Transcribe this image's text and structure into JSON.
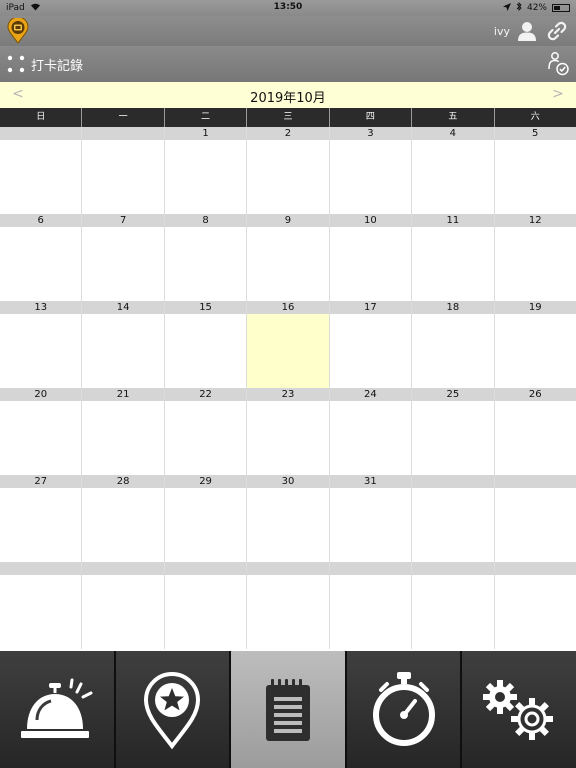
{
  "status_bar": {
    "device": "iPad",
    "time": "13:50",
    "battery": "42%",
    "battery_level": 0.42
  },
  "header": {
    "user_name": "ivy",
    "page_title": "打卡記錄"
  },
  "calendar": {
    "month_title": "2019年10月",
    "prev_label": "<",
    "next_label": ">",
    "weekdays": [
      "日",
      "一",
      "二",
      "三",
      "四",
      "五",
      "六"
    ],
    "today": "16",
    "weeks": [
      [
        "",
        "",
        "1",
        "2",
        "3",
        "4",
        "5"
      ],
      [
        "6",
        "7",
        "8",
        "9",
        "10",
        "11",
        "12"
      ],
      [
        "13",
        "14",
        "15",
        "16",
        "17",
        "18",
        "19"
      ],
      [
        "20",
        "21",
        "22",
        "23",
        "24",
        "25",
        "26"
      ],
      [
        "27",
        "28",
        "29",
        "30",
        "31",
        "",
        ""
      ],
      [
        "",
        "",
        "",
        "",
        "",
        "",
        ""
      ]
    ]
  },
  "tab_bar": {
    "active_index": 2,
    "tabs": [
      {
        "icon": "service-bell-icon"
      },
      {
        "icon": "location-star-icon"
      },
      {
        "icon": "notepad-icon"
      },
      {
        "icon": "stopwatch-icon"
      },
      {
        "icon": "settings-gears-icon"
      }
    ]
  },
  "colors": {
    "today_highlight": "#ffffcc",
    "month_header_bg": "#ffffd6",
    "weekday_header_bg": "#2b2b2b",
    "active_tab_bg": "#b0b0b0",
    "logo_accent": "#e8a317"
  }
}
